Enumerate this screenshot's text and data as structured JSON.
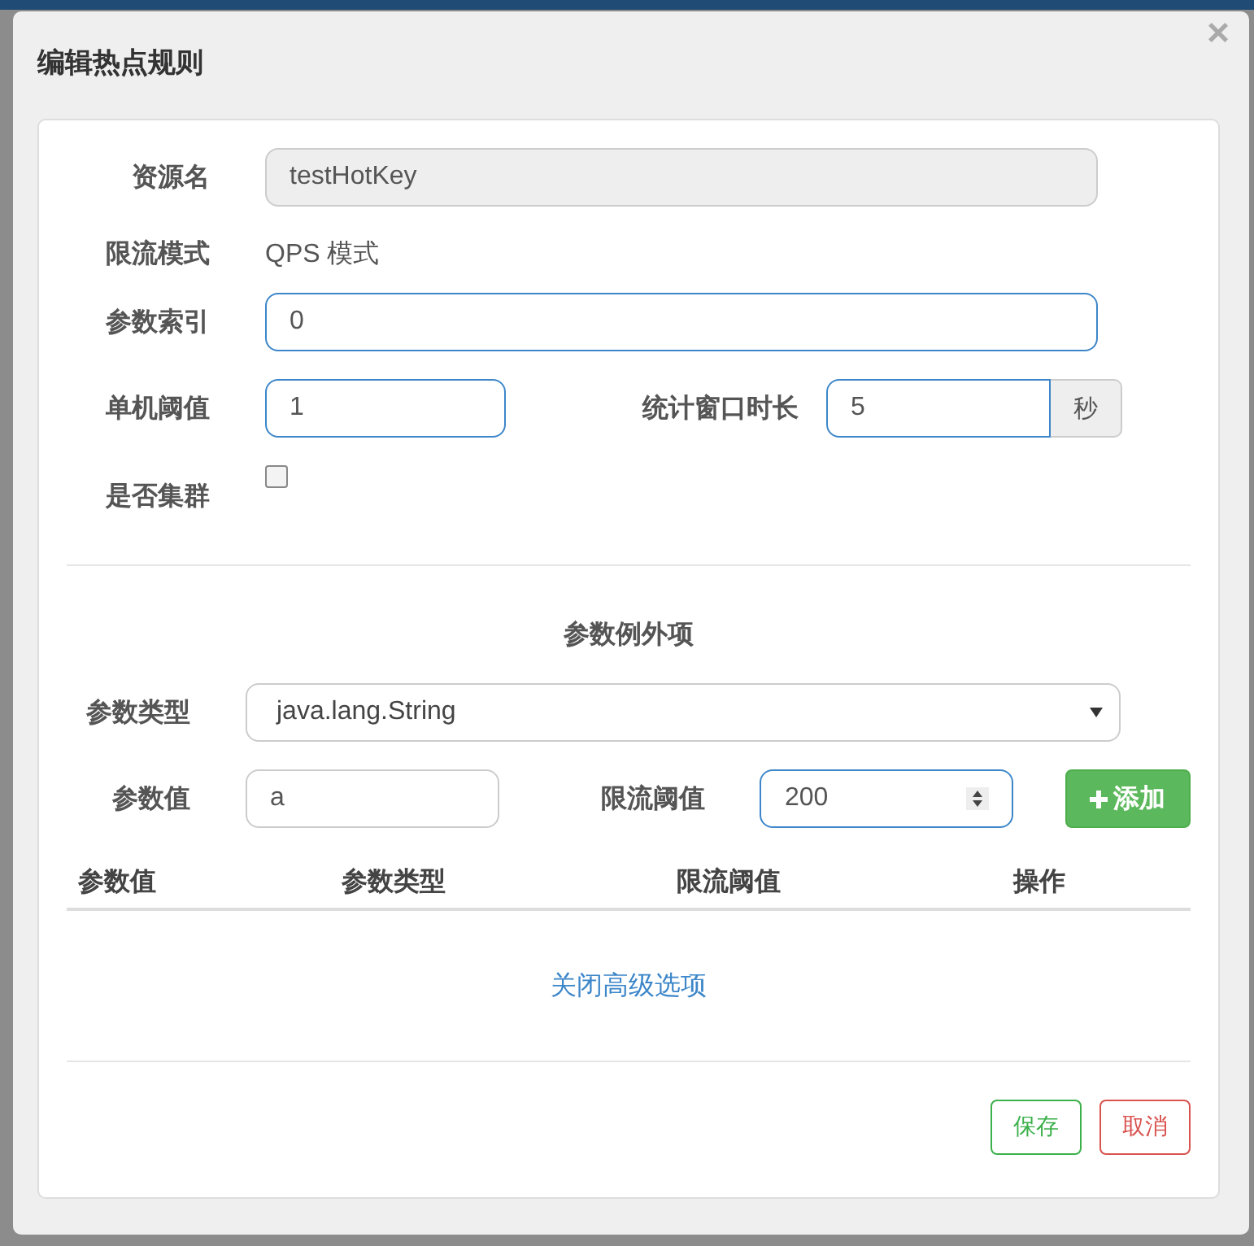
{
  "dialog": {
    "title": "编辑热点规则",
    "close": "×"
  },
  "form": {
    "resource": {
      "label": "资源名",
      "value": "testHotKey",
      "disabled": true
    },
    "mode": {
      "label": "限流模式",
      "value": "QPS 模式"
    },
    "param_index": {
      "label": "参数索引",
      "value": "0"
    },
    "threshold": {
      "label": "单机阈值",
      "value": "1"
    },
    "window": {
      "label": "统计窗口时长",
      "value": "5",
      "unit": "秒"
    },
    "cluster": {
      "label": "是否集群",
      "checked": false
    }
  },
  "exceptions": {
    "title": "参数例外项",
    "param_type": {
      "label": "参数类型",
      "value": "java.lang.String"
    },
    "param_value": {
      "label": "参数值",
      "value": "a"
    },
    "limit": {
      "label": "限流阈值",
      "value": "200"
    },
    "add_button": "添加",
    "table": {
      "columns": [
        "参数值",
        "参数类型",
        "限流阈值",
        "操作"
      ]
    }
  },
  "advanced_link": "关闭高级选项",
  "buttons": [
    {
      "label": "保存",
      "kind": "save"
    },
    {
      "label": "取消",
      "kind": "cancel"
    }
  ]
}
